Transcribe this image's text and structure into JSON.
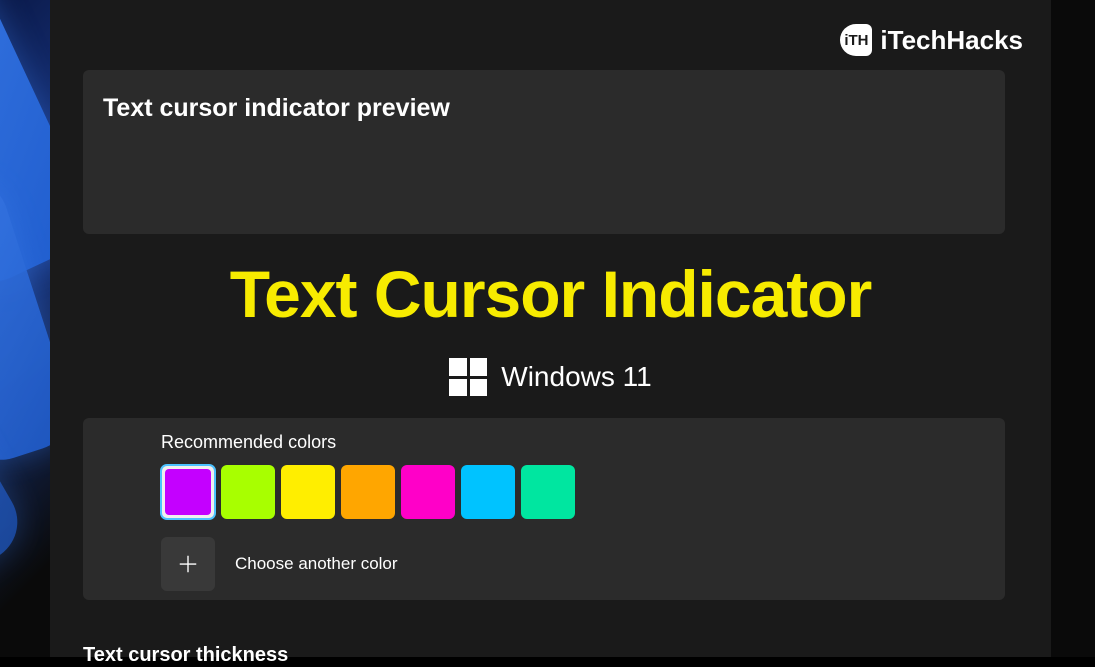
{
  "watermark": {
    "icon_text": "iTH",
    "text": "iTechHacks"
  },
  "preview": {
    "title": "Text cursor indicator preview"
  },
  "hero": {
    "title": "Text Cursor Indicator",
    "brand": "Windows 11"
  },
  "colors_section": {
    "label": "Recommended colors",
    "choose_another": "Choose another color",
    "swatches": [
      {
        "hex": "#c400ff",
        "selected": true
      },
      {
        "hex": "#a8ff00",
        "selected": false
      },
      {
        "hex": "#ffee00",
        "selected": false
      },
      {
        "hex": "#ffa600",
        "selected": false
      },
      {
        "hex": "#ff00c8",
        "selected": false
      },
      {
        "hex": "#00c3ff",
        "selected": false
      },
      {
        "hex": "#00e6a0",
        "selected": false
      }
    ]
  },
  "thickness": {
    "label": "Text cursor thickness"
  }
}
